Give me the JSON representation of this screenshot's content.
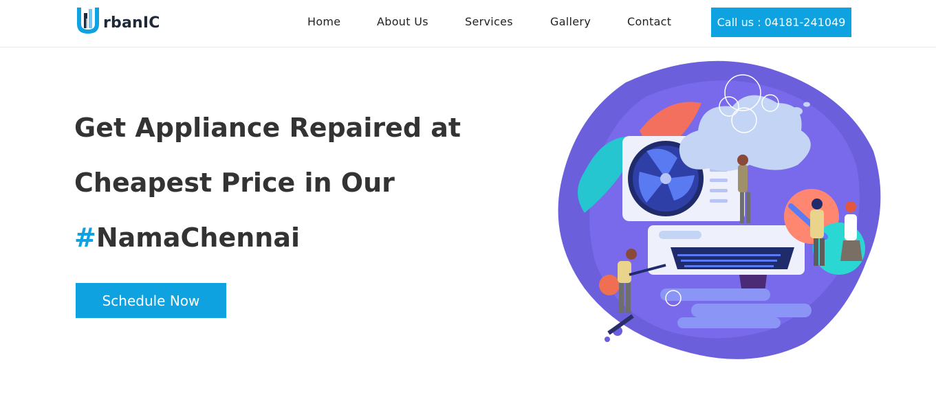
{
  "brand": {
    "name": "rbanIC",
    "logo_letter": "U",
    "accent_color": "#0ea2e0"
  },
  "nav": {
    "items": [
      {
        "label": "Home"
      },
      {
        "label": "About Us"
      },
      {
        "label": "Services"
      },
      {
        "label": "Gallery"
      },
      {
        "label": "Contact"
      }
    ],
    "call_button": "Call us : 04181-241049"
  },
  "hero": {
    "title_line1": "Get Appliance Repaired at",
    "title_line2": "Cheapest Price in Our",
    "title_hash": "#",
    "title_line3": "NamaChennai",
    "cta_label": "Schedule Now"
  },
  "illustration": {
    "subject": "air-conditioner-repair-illustration"
  }
}
